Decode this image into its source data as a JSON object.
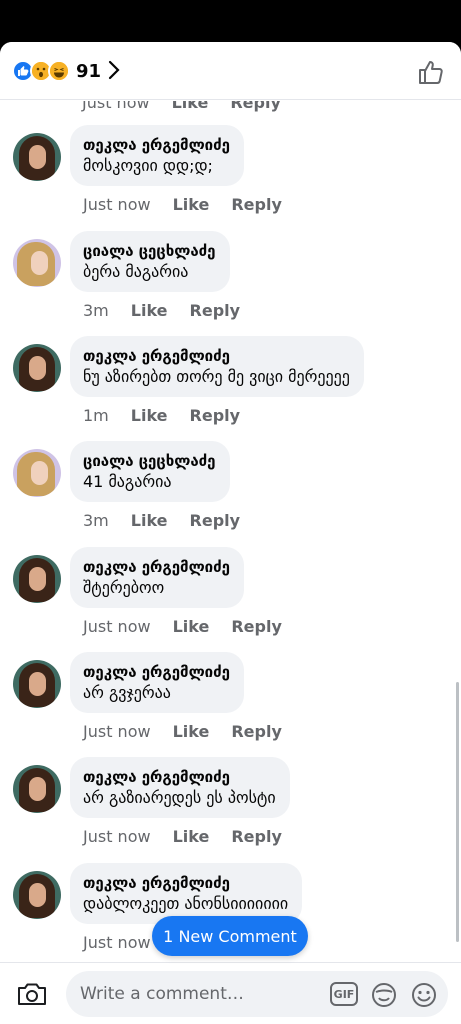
{
  "header": {
    "reactions": [
      "like",
      "wow",
      "haha"
    ],
    "reaction_count": "91"
  },
  "partial_top": {
    "time": "Just now",
    "like": "Like",
    "reply": "Reply"
  },
  "comments": [
    {
      "author": "თეკლა ერგემლიძე",
      "text": "მოსკოვიი დდ;დ;",
      "time": "Just now",
      "like": "Like",
      "reply": "Reply",
      "avatar": "a"
    },
    {
      "author": "ციალა ცეცხლაძე",
      "text": "ბერა მაგარია",
      "time": "3m",
      "like": "Like",
      "reply": "Reply",
      "avatar": "b"
    },
    {
      "author": "თეკლა ერგემლიძე",
      "text": "ნუ აზირებთ თორე მე ვიცი მერეეეე",
      "time": "1m",
      "like": "Like",
      "reply": "Reply",
      "avatar": "a"
    },
    {
      "author": "ციალა ცეცხლაძე",
      "text": "41 მაგარია",
      "time": "3m",
      "like": "Like",
      "reply": "Reply",
      "avatar": "b"
    },
    {
      "author": "თეკლა ერგემლიძე",
      "text": "შტერებოო",
      "time": "Just now",
      "like": "Like",
      "reply": "Reply",
      "avatar": "a"
    },
    {
      "author": "თეკლა ერგემლიძე",
      "text": "არ გვჯერაა",
      "time": "Just now",
      "like": "Like",
      "reply": "Reply",
      "avatar": "a"
    },
    {
      "author": "თეკლა ერგემლიძე",
      "text": "არ გაზიარედეს ეს პოსტი",
      "time": "Just now",
      "like": "Like",
      "reply": "Reply",
      "avatar": "a"
    },
    {
      "author": "თეკლა ერგემლიძე",
      "text": "დაბლოკეეთ ანონსიიიიიიი",
      "time": "Just now",
      "like": "",
      "reply": "",
      "avatar": "a"
    }
  ],
  "new_comment_pill": "1 New Comment",
  "composer": {
    "placeholder": "Write a comment…",
    "gif_label": "GIF"
  }
}
